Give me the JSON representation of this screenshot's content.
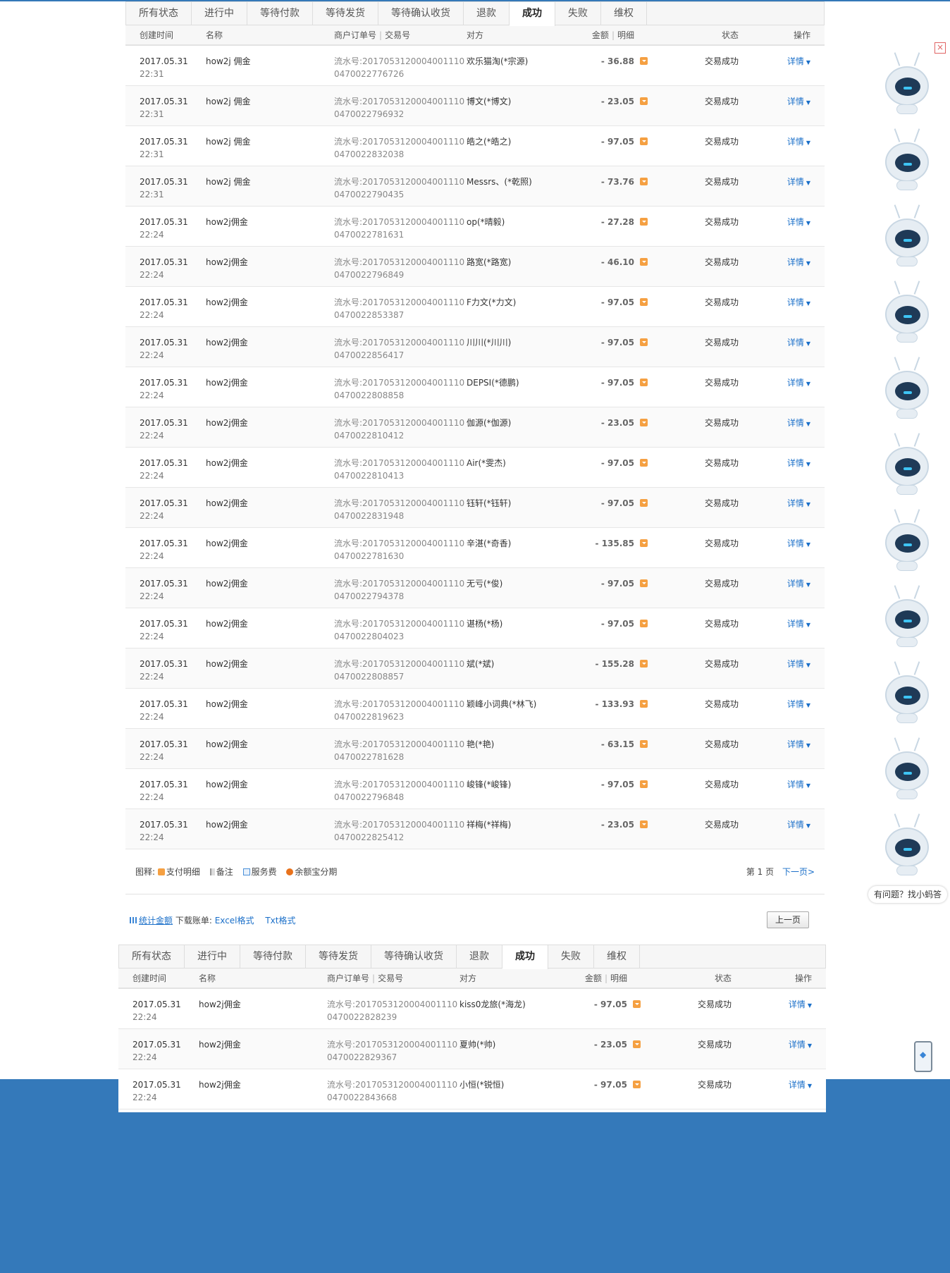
{
  "tabs": [
    "所有状态",
    "进行中",
    "等待付款",
    "等待发货",
    "等待确认收货",
    "退款",
    "成功",
    "失败",
    "维权"
  ],
  "active_tab_index": 6,
  "columns": {
    "time": "创建时间",
    "name": "名称",
    "order": "商户订单号",
    "trade": "交易号",
    "party": "对方",
    "amount": "金额",
    "detail": "明细",
    "status": "状态",
    "op": "操作"
  },
  "serial_prefix": "流水号:2017053120004001110",
  "status_text": "交易成功",
  "detail_link": "详情",
  "rows": [
    {
      "date": "2017.05.31",
      "time": "22:31",
      "name": "how2j 佣金",
      "serial2": "0470022776726",
      "party": "欢乐猫淘(*宗源)",
      "amount": "- 36.88"
    },
    {
      "date": "2017.05.31",
      "time": "22:31",
      "name": "how2j 佣金",
      "serial2": "0470022796932",
      "party": "博文(*博文)",
      "amount": "- 23.05"
    },
    {
      "date": "2017.05.31",
      "time": "22:31",
      "name": "how2j 佣金",
      "serial2": "0470022832038",
      "party": "皓之(*皓之)",
      "amount": "- 97.05"
    },
    {
      "date": "2017.05.31",
      "time": "22:31",
      "name": "how2j 佣金",
      "serial2": "0470022790435",
      "party": "Messrs、(*乾照)",
      "amount": "- 73.76"
    },
    {
      "date": "2017.05.31",
      "time": "22:24",
      "name": "how2j佣金",
      "serial2": "0470022781631",
      "party": "op(*晴毅)",
      "amount": "- 27.28"
    },
    {
      "date": "2017.05.31",
      "time": "22:24",
      "name": "how2j佣金",
      "serial2": "0470022796849",
      "party": "路宽(*路宽)",
      "amount": "- 46.10"
    },
    {
      "date": "2017.05.31",
      "time": "22:24",
      "name": "how2j佣金",
      "serial2": "0470022853387",
      "party": "F力文(*力文)",
      "amount": "- 97.05"
    },
    {
      "date": "2017.05.31",
      "time": "22:24",
      "name": "how2j佣金",
      "serial2": "0470022856417",
      "party": "川川(*川川)",
      "amount": "- 97.05"
    },
    {
      "date": "2017.05.31",
      "time": "22:24",
      "name": "how2j佣金",
      "serial2": "0470022808858",
      "party": "DEPSI(*德鹏)",
      "amount": "- 97.05"
    },
    {
      "date": "2017.05.31",
      "time": "22:24",
      "name": "how2j佣金",
      "serial2": "0470022810412",
      "party": "伽源(*伽源)",
      "amount": "- 23.05"
    },
    {
      "date": "2017.05.31",
      "time": "22:24",
      "name": "how2j佣金",
      "serial2": "0470022810413",
      "party": "Air(*雯杰)",
      "amount": "- 97.05"
    },
    {
      "date": "2017.05.31",
      "time": "22:24",
      "name": "how2j佣金",
      "serial2": "0470022831948",
      "party": "钰轩(*钰轩)",
      "amount": "- 97.05"
    },
    {
      "date": "2017.05.31",
      "time": "22:24",
      "name": "how2j佣金",
      "serial2": "0470022781630",
      "party": "辛湛(*奇香)",
      "amount": "- 135.85"
    },
    {
      "date": "2017.05.31",
      "time": "22:24",
      "name": "how2j佣金",
      "serial2": "0470022794378",
      "party": "无亏(*俊)",
      "amount": "- 97.05"
    },
    {
      "date": "2017.05.31",
      "time": "22:24",
      "name": "how2j佣金",
      "serial2": "0470022804023",
      "party": "谌杨(*杨)",
      "amount": "- 97.05"
    },
    {
      "date": "2017.05.31",
      "time": "22:24",
      "name": "how2j佣金",
      "serial2": "0470022808857",
      "party": "斌(*斌)",
      "amount": "- 155.28"
    },
    {
      "date": "2017.05.31",
      "time": "22:24",
      "name": "how2j佣金",
      "serial2": "0470022819623",
      "party": "颖峰小词典(*林飞)",
      "amount": "- 133.93"
    },
    {
      "date": "2017.05.31",
      "time": "22:24",
      "name": "how2j佣金",
      "serial2": "0470022781628",
      "party": "艳(*艳)",
      "amount": "- 63.15"
    },
    {
      "date": "2017.05.31",
      "time": "22:24",
      "name": "how2j佣金",
      "serial2": "0470022796848",
      "party": "峻锋(*峻锋)",
      "amount": "- 97.05"
    },
    {
      "date": "2017.05.31",
      "time": "22:24",
      "name": "how2j佣金",
      "serial2": "0470022825412",
      "party": "祥梅(*祥梅)",
      "amount": "- 23.05"
    }
  ],
  "legend": {
    "label": "图释:",
    "items": [
      "支付明细",
      "备注",
      "服务费",
      "余额宝分期"
    ]
  },
  "pager": {
    "page": "第 1 页",
    "next": "下一页>"
  },
  "stat": {
    "total_link": "统计金额",
    "download_label": "下载账单:",
    "excel": "Excel格式",
    "txt": "Txt格式",
    "prev_button": "上一页"
  },
  "rows2": [
    {
      "date": "2017.05.31",
      "time": "22:24",
      "name": "how2j佣金",
      "serial2": "0470022828239",
      "party": "kiss0龙旅(*海龙)",
      "amount": "- 97.05"
    },
    {
      "date": "2017.05.31",
      "time": "22:24",
      "name": "how2j佣金",
      "serial2": "0470022829367",
      "party": "夏帅(*帅)",
      "amount": "- 23.05"
    },
    {
      "date": "2017.05.31",
      "time": "22:24",
      "name": "how2j佣金",
      "serial2": "0470022843668",
      "party": "小恒(*锐恒)",
      "amount": "- 97.05"
    }
  ],
  "assistant": {
    "ask": "有问题？找小蚂答",
    "close": "×"
  },
  "colors": {
    "brand_blue": "#3479ba",
    "link": "#1a6fc9",
    "detail_icon": "#f5a042"
  }
}
